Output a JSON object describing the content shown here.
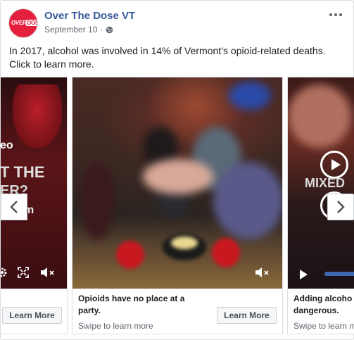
{
  "post": {
    "page_name": "Over The Dose VT",
    "date": "September 10",
    "date_separator": "·",
    "text": "In 2017, alcohol was involved in 14% of Vermont’s opioid-related deaths. Click to learn more.",
    "avatar_logo": {
      "over": "OVER",
      "dose": "DOSE"
    }
  },
  "carousel": {
    "cards": [
      {
        "overlay_lines": [
          "eo",
          "T THE",
          "ER?",
          "m"
        ],
        "button_label": "Learn More"
      },
      {
        "caption": "Opioids have no place at a party.",
        "subcaption": "Swipe to learn more",
        "button_label": "Learn More"
      },
      {
        "overlay_text": "MIXED",
        "caption": "Adding alcoho",
        "caption_line2": "dangerous.",
        "subcaption": "Swipe to learn m"
      }
    ]
  },
  "colors": {
    "link": "#385898",
    "brand_red": "#e5203f",
    "accent_blue": "#4267b2"
  },
  "icons": {
    "more": "more-options-icon",
    "audience": "globe-icon",
    "prev": "chevron-left-icon",
    "next": "chevron-right-icon",
    "mute": "mute-icon",
    "play": "play-icon",
    "settings": "gear-icon",
    "fullscreen": "fullscreen-icon"
  }
}
